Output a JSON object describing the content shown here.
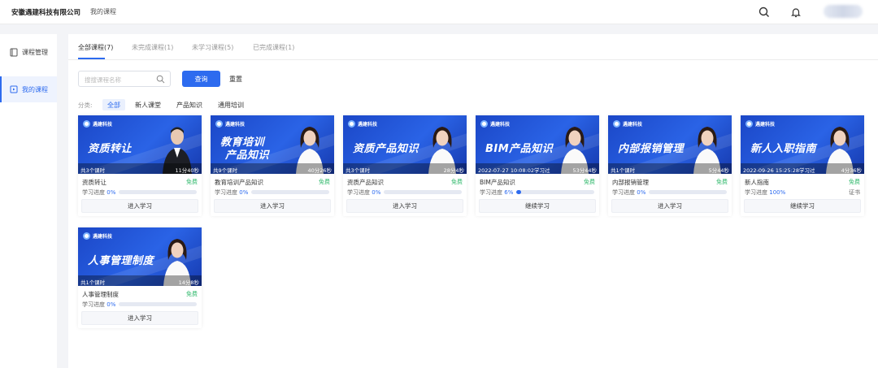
{
  "header": {
    "company": "安徽遇建科技有限公司",
    "nav": "我的课程"
  },
  "sidebar": {
    "items": [
      {
        "label": "课程管理",
        "icon": "book-icon",
        "active": false
      },
      {
        "label": "我的课程",
        "icon": "course-icon",
        "active": true
      }
    ]
  },
  "tabs": [
    {
      "label": "全部课程(7)",
      "active": true
    },
    {
      "label": "未完成课程(1)",
      "active": false
    },
    {
      "label": "未学习课程(5)",
      "active": false
    },
    {
      "label": "已完成课程(1)",
      "active": false
    }
  ],
  "search": {
    "placeholder": "搜搜课程名称",
    "query_label": "查询",
    "reset_label": "重置"
  },
  "category": {
    "label": "分类:",
    "chips": [
      {
        "label": "全部",
        "active": true
      },
      {
        "label": "新人课堂",
        "active": false
      },
      {
        "label": "产品知识",
        "active": false
      },
      {
        "label": "通用培训",
        "active": false
      }
    ]
  },
  "logo_text": "遇建科技",
  "accent_color": "#2d6bef",
  "free_color": "#2fb86b",
  "progress_label": "学习进度",
  "courses": [
    {
      "banner_title_1": "资质转让",
      "banner_title_2": "",
      "foot_left": "共3个课时",
      "foot_right": "11分40秒",
      "name": "资质转让",
      "price": "免费",
      "progress": "0%",
      "progress_value": 0,
      "action": "进入学习",
      "cert": "",
      "person": "man"
    },
    {
      "banner_title_1": "教育培训",
      "banner_title_2": "产品知识",
      "foot_left": "共9个课时",
      "foot_right": "40分26秒",
      "name": "教育培训产品知识",
      "price": "免费",
      "progress": "0%",
      "progress_value": 0,
      "action": "进入学习",
      "cert": "",
      "person": "woman"
    },
    {
      "banner_title_1": "资质产品知识",
      "banner_title_2": "",
      "foot_left": "共3个课时",
      "foot_right": "28分4秒",
      "name": "资质产品知识",
      "price": "免费",
      "progress": "0%",
      "progress_value": 0,
      "action": "进入学习",
      "cert": "",
      "person": "woman"
    },
    {
      "banner_title_1": "BIM产品知识",
      "banner_title_2": "",
      "foot_left": "2022-07-27 10:08:02学习过",
      "foot_right": "53分44秒",
      "name": "BIM产品知识",
      "price": "免费",
      "progress": "6%",
      "progress_value": 6,
      "action": "继续学习",
      "cert": "",
      "person": "woman"
    },
    {
      "banner_title_1": "内部报销管理",
      "banner_title_2": "",
      "foot_left": "共1个课时",
      "foot_right": "5分44秒",
      "name": "内部报销管理",
      "price": "免费",
      "progress": "0%",
      "progress_value": 0,
      "action": "进入学习",
      "cert": "",
      "person": "woman"
    },
    {
      "banner_title_1": "新人入职指南",
      "banner_title_2": "",
      "foot_left": "2022-09-26 15:25:28学习过",
      "foot_right": "4分36秒",
      "name": "新人指南",
      "price": "免费",
      "progress": "100%",
      "progress_value": 100,
      "action": "继续学习",
      "cert": "证书",
      "person": "woman"
    },
    {
      "banner_title_1": "人事管理制度",
      "banner_title_2": "",
      "foot_left": "共1个课时",
      "foot_right": "14分8秒",
      "name": "人事管理制度",
      "price": "免费",
      "progress": "0%",
      "progress_value": 0,
      "action": "进入学习",
      "cert": "",
      "person": "woman"
    }
  ]
}
